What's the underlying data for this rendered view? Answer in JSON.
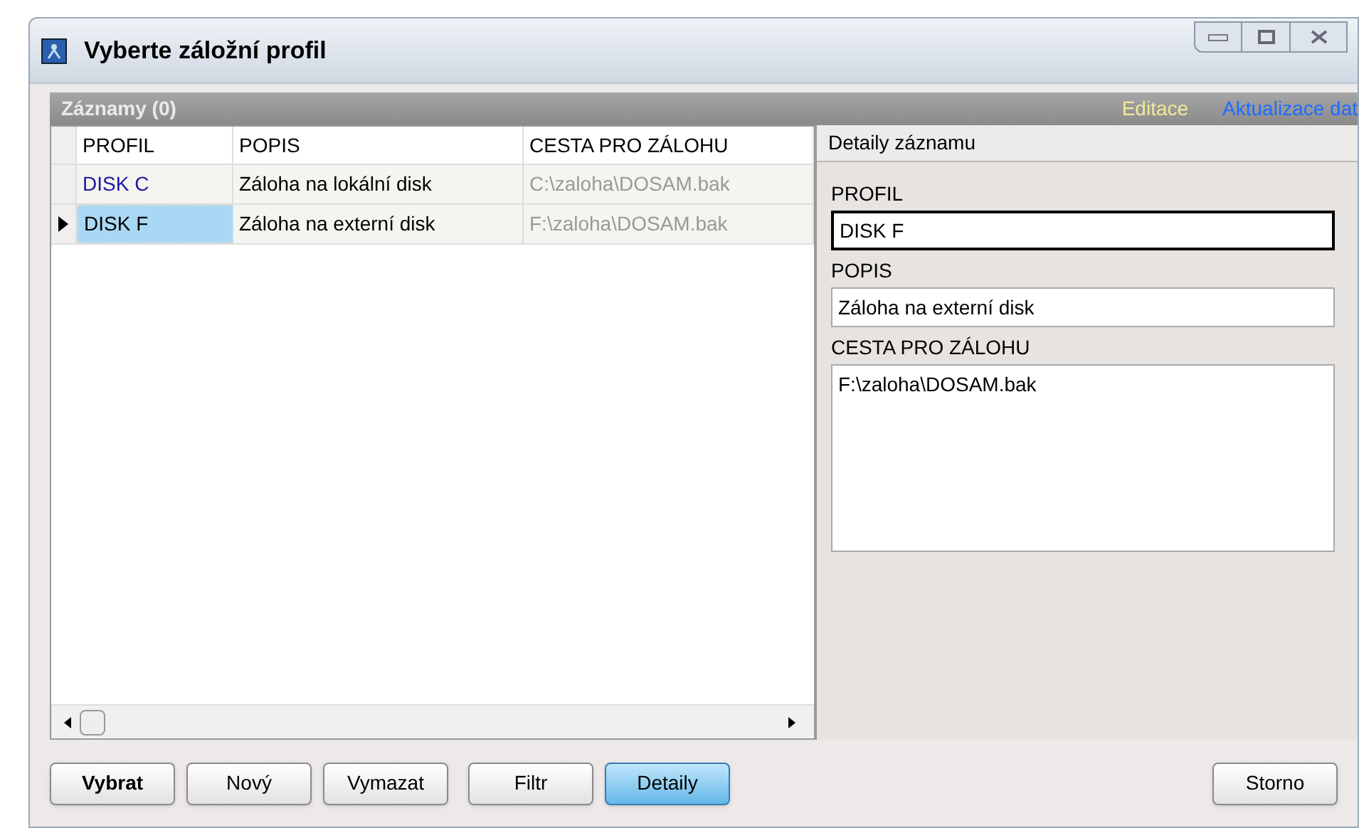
{
  "window": {
    "title": "Vyberte záložní profil"
  },
  "panel": {
    "title": "Záznamy (0)",
    "links": [
      {
        "label": "Editace",
        "color": "#f0ea9a"
      },
      {
        "label": "Aktualizace dat",
        "color": "#1e6cff"
      }
    ]
  },
  "table": {
    "columns": [
      "PROFIL",
      "POPIS",
      "CESTA PRO ZÁLOHU"
    ],
    "rows": [
      {
        "cells": [
          "DISK C",
          "Záloha na lokální disk",
          "C:\\zaloha\\DOSAM.bak"
        ],
        "selected": false
      },
      {
        "cells": [
          "DISK F",
          "Záloha na externí disk",
          "F:\\zaloha\\DOSAM.bak"
        ],
        "selected": true
      }
    ]
  },
  "details": {
    "title": "Detaily záznamu",
    "fields": [
      {
        "label": "PROFIL",
        "value": "DISK F",
        "focused": true
      },
      {
        "label": "POPIS",
        "value": "Záloha na externí disk",
        "focused": false
      },
      {
        "label": "CESTA PRO ZÁLOHU",
        "value": "F:\\zaloha\\DOSAM.bak",
        "focused": false,
        "kind": "multiline"
      }
    ]
  },
  "buttons": [
    {
      "label": "Vybrat",
      "bold": true,
      "pressed": false
    },
    {
      "label": "Nový",
      "bold": false,
      "pressed": false
    },
    {
      "label": "Vymazat",
      "bold": false,
      "pressed": false
    },
    {
      "label": "Filtr",
      "bold": false,
      "pressed": false
    },
    {
      "label": "Detaily",
      "bold": false,
      "pressed": true
    },
    {
      "label": "Storno",
      "bold": false,
      "pressed": false
    }
  ]
}
